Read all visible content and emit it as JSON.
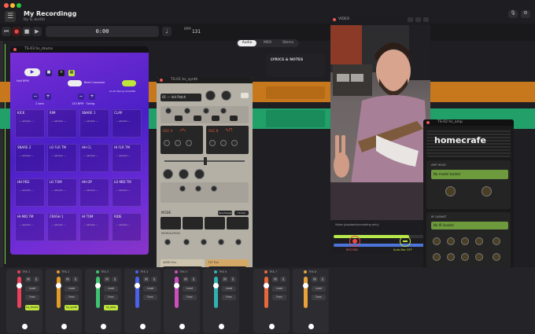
{
  "app": {
    "title": "My Recordingg",
    "subtitle": "by & audio"
  },
  "transport": {
    "time": "0:00",
    "bpm_label": "BPM",
    "bpm": "131"
  },
  "view_tabs": [
    "Audio",
    "MIDI",
    "Stems"
  ],
  "lyrics_panel": {
    "title": "LYRICS & NOTES"
  },
  "drums": {
    "title": "TS-03  hs_drums",
    "labels": {
      "sep1": "Half BPM",
      "sep2": "Half Swing",
      "sep3": "Beat Crossover",
      "sep4": "Lo-sh Swung Amplifier"
    },
    "bars_label": "2 bars",
    "bpm_info": "120 BPM · Swing",
    "pads": [
      "KICK",
      "RIM",
      "SNARE 1",
      "CLAP",
      "SNARE 2",
      "LO FLR TM",
      "HH CL",
      "HI FLR TM",
      "HH PED",
      "LO TOM",
      "HH OP",
      "LO-MID TM",
      "HI-MID TM",
      "CRASH 1",
      "HI TOM",
      "RIDE"
    ],
    "pad_sub": "— sample —"
  },
  "synth": {
    "title": "TS-01  hs_synth",
    "patch": "01 — Init Patch",
    "osc_labels": [
      "OSC A",
      "OSC B"
    ],
    "filter_label": "FILTER",
    "modes_label": "MODE",
    "mode_btns": [
      "Tone Preset",
      "Hi Cut"
    ],
    "mod_label": "MODULATION",
    "env_labels": [
      "ADSR Env",
      "FLT Env"
    ]
  },
  "video": {
    "title": "VIDEO",
    "caption": "Video (playback/recording only)",
    "buttons": {
      "record": "RECORD",
      "off": "Auto-Rec OFF"
    }
  },
  "amp": {
    "title": "TS-02  hs_amp",
    "brand": "homecrafe",
    "amp_head": "AMP HEAD",
    "no_model": "No model loaded",
    "cabinet": "IR CABINET",
    "no_ir": "No IR loaded",
    "footer": "Presets",
    "footer_btn": "Save to Preset"
  },
  "mixer": {
    "tracks": [
      {
        "label": "TRK 1",
        "name": "hs_drums",
        "color": "#e9415a"
      },
      {
        "label": "TRK 2",
        "name": "hs_synth",
        "color": "#e39b27"
      },
      {
        "label": "TRK 3",
        "name": "hs_amp",
        "color": "#3ec26f"
      },
      {
        "label": "TRK 4",
        "name": "",
        "color": "#4a63ea"
      },
      {
        "label": "TRK 5",
        "name": "",
        "color": "#cc4fbd"
      },
      {
        "label": "TRK 6",
        "name": "",
        "color": "#2fb2b0"
      },
      {
        "label": "TRK 7",
        "name": "",
        "color": "#e7683b"
      },
      {
        "label": "TRK 8",
        "name": "",
        "color": "#e9a13b"
      }
    ],
    "btns": [
      "M",
      "S"
    ],
    "strip_words": [
      "Load",
      "Free"
    ]
  }
}
